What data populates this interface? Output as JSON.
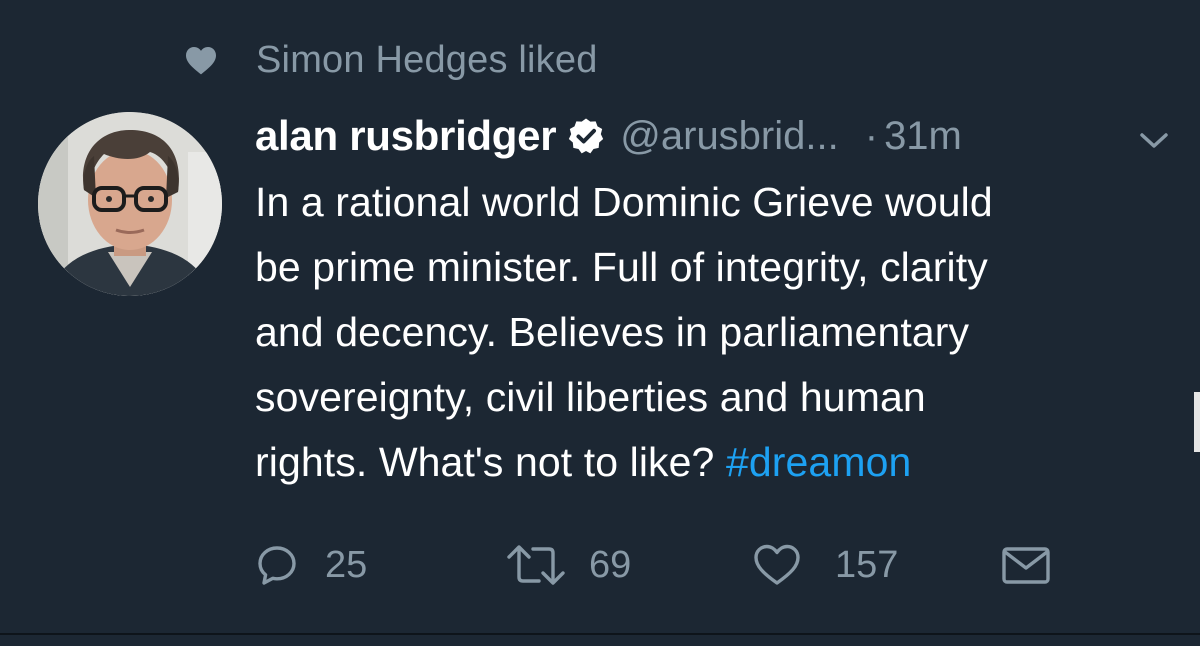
{
  "social_context": {
    "text": "Simon Hedges liked",
    "icon": "heart-icon"
  },
  "tweet": {
    "author": {
      "display_name": "alan rusbridger",
      "verified": true,
      "handle": "@arusbrid...",
      "avatar_icon": "avatar"
    },
    "separator": "·",
    "time": "31m",
    "text_lines": [
      "In a rational world Dominic Grieve would",
      "be prime minister. Full of integrity, clarity",
      "and decency. Believes in parliamentary",
      "sovereignty, civil liberties and human",
      "rights. What's not to like?"
    ],
    "hashtag": "#dreamon",
    "actions": {
      "reply": {
        "icon": "reply-icon",
        "count": "25"
      },
      "retweet": {
        "icon": "retweet-icon",
        "count": "69"
      },
      "like": {
        "icon": "heart-outline-icon",
        "count": "157"
      },
      "dm": {
        "icon": "envelope-icon"
      }
    }
  },
  "colors": {
    "background": "#1c2733",
    "text": "#ffffff",
    "muted": "#8899a6",
    "link": "#1da1f2"
  }
}
